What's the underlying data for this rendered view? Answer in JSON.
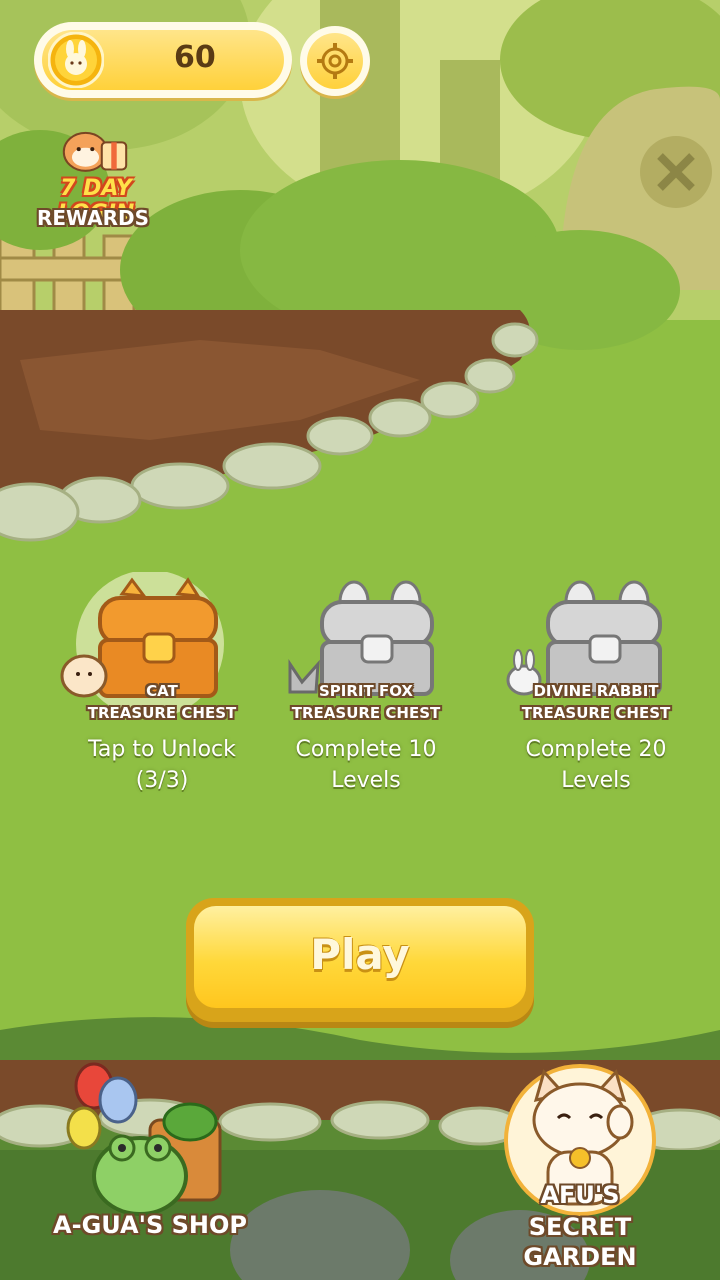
{
  "hud": {
    "coins": "60",
    "coin_icon": "bunny-coin-icon",
    "settings_icon": "gear-icon"
  },
  "login_rewards": {
    "day_label": "7 DAY LOGIN",
    "rewards_label": "REWARDS"
  },
  "chests": [
    {
      "name_line1": "CAT",
      "name_line2": "TREASURE CHEST",
      "status_line1": "Tap to Unlock",
      "status_line2": "(3/3)",
      "unlocked": true
    },
    {
      "name_line1": "SPIRIT FOX",
      "name_line2": "TREASURE CHEST",
      "status_line1": "Complete 10",
      "status_line2": "Levels",
      "unlocked": false
    },
    {
      "name_line1": "DIVINE RABBIT",
      "name_line2": "TREASURE CHEST",
      "status_line1": "Complete 20",
      "status_line2": "Levels",
      "unlocked": false
    }
  ],
  "play": {
    "label": "Play"
  },
  "shops": {
    "shop_label": "A-GUA'S SHOP",
    "garden_line1": "AFU'S",
    "garden_line2": "SECRET GARDEN"
  },
  "colors": {
    "grass": "#8fbf43",
    "gold": "#ffd13a",
    "soil": "#7a4a2a"
  }
}
